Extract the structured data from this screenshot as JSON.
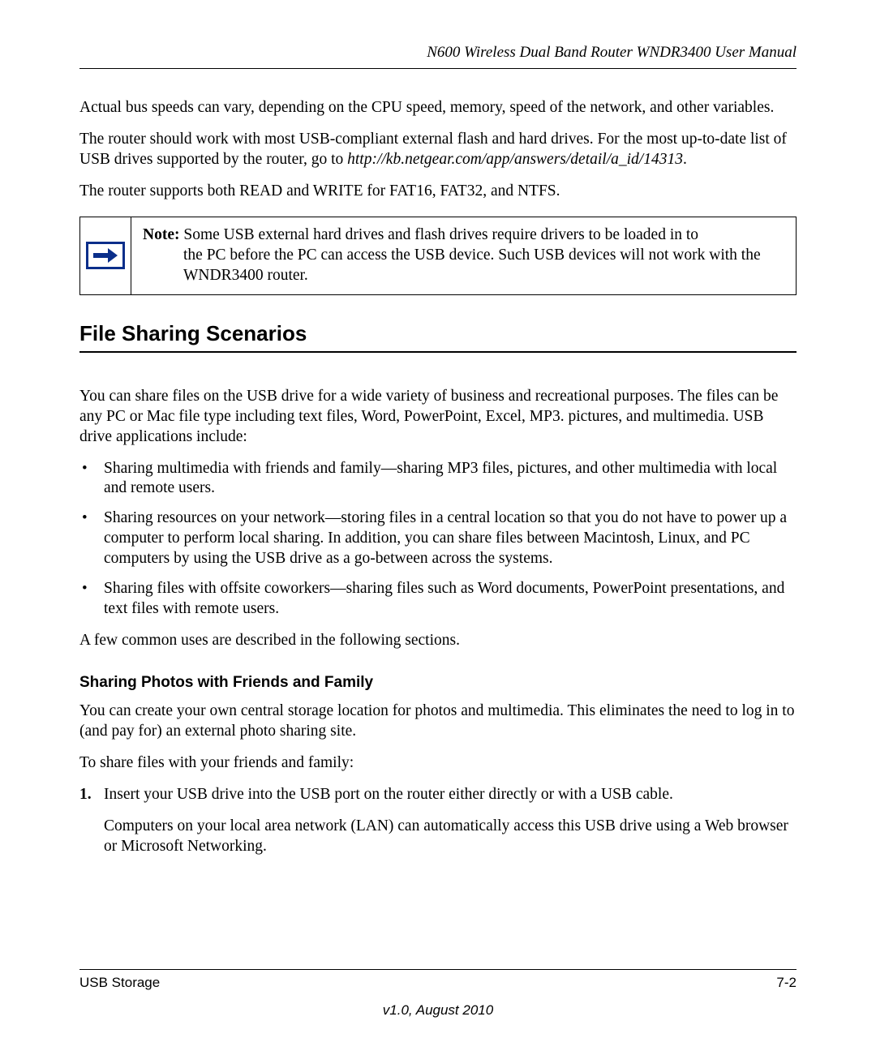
{
  "header": {
    "title": "N600 Wireless Dual Band Router WNDR3400 User Manual"
  },
  "paragraphs": {
    "p1": "Actual bus speeds can vary, depending on the CPU speed, memory, speed of the network, and other variables.",
    "p2a": "The router should work with most USB-compliant external flash and hard drives. For the most up-to-date list of USB drives supported by the router, go to ",
    "p2b_url": "http://kb.netgear.com/app/answers/detail/a_id/14313",
    "p2c": ".",
    "p3": "The router supports both READ and WRITE for FAT16, FAT32, and NTFS."
  },
  "note": {
    "label": "Note:",
    "line1": " Some USB external hard drives and flash drives require drivers to be loaded in to",
    "line2": "the PC before the PC can access the USB device. Such USB devices will not work with the WNDR3400 router."
  },
  "section": {
    "heading": "File Sharing Scenarios",
    "intro": "You can share files on the USB drive for a wide variety of business and recreational purposes. The files can be any PC or Mac file type including text files, Word, PowerPoint, Excel, MP3. pictures, and multimedia. USB drive applications include:",
    "bullets": [
      "Sharing multimedia with friends and family—sharing MP3 files, pictures, and other multimedia with local and remote users.",
      "Sharing resources on your network—storing files in a central location so that you do not have to power up a computer to perform local sharing. In addition, you can share files between Macintosh, Linux, and PC computers by using the USB drive as a go-between across the systems.",
      "Sharing files with offsite coworkers—sharing files such as Word documents, PowerPoint presentations, and text files with remote users."
    ],
    "outro": "A few common uses are described in the following sections."
  },
  "subsection": {
    "heading": "Sharing Photos with Friends and Family",
    "p1": "You can create your own central storage location for photos and multimedia. This eliminates the need to log in to (and pay for) an external photo sharing site.",
    "p2": "To share files with your friends and family:",
    "steps": [
      {
        "num": "1.",
        "text": "Insert your USB drive into the USB port on the router either directly or with a USB cable.",
        "sub": "Computers on your local area network (LAN) can automatically access this USB drive using a Web browser or Microsoft Networking."
      }
    ]
  },
  "footer": {
    "left": "USB Storage",
    "right": "7-2",
    "version": "v1.0, August 2010"
  }
}
